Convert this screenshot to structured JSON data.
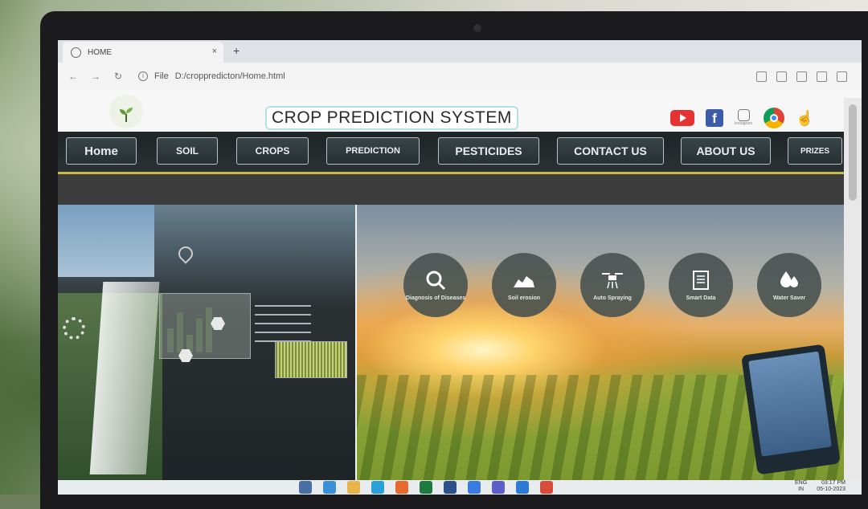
{
  "browser": {
    "tab_title": "HOME",
    "tab_close": "×",
    "new_tab": "+",
    "url_label": "File",
    "url": "D:/croppredicton/Home.html"
  },
  "header": {
    "title": "CROP PREDICTION SYSTEM"
  },
  "nav": {
    "items": [
      {
        "label": "Home"
      },
      {
        "label": "SOIL"
      },
      {
        "label": "CROPS"
      },
      {
        "label": "PREDICTION"
      },
      {
        "label": "PESTICIDES"
      },
      {
        "label": "CONTACT US"
      },
      {
        "label": "ABOUT US"
      },
      {
        "label": "PRIZES"
      }
    ]
  },
  "features": [
    {
      "label": "Diagnosis of Diseases",
      "icon": "magnifier-icon"
    },
    {
      "label": "Soil erosion",
      "icon": "soil-icon"
    },
    {
      "label": "Auto Spraying",
      "icon": "drone-icon"
    },
    {
      "label": "Smart Data",
      "icon": "document-icon"
    },
    {
      "label": "Water Saver",
      "icon": "water-drop-icon"
    }
  ],
  "social": {
    "instagram_caption": "Instagram"
  },
  "taskbar": {
    "lang_top": "ENG",
    "lang_bottom": "IN",
    "time": "03:17 PM",
    "date": "05-10-2023"
  },
  "colors": {
    "nav_bg": "#263033",
    "nav_border": "#c8b84a",
    "title_border": "#aee3e3",
    "feature_circle": "#46504e"
  }
}
